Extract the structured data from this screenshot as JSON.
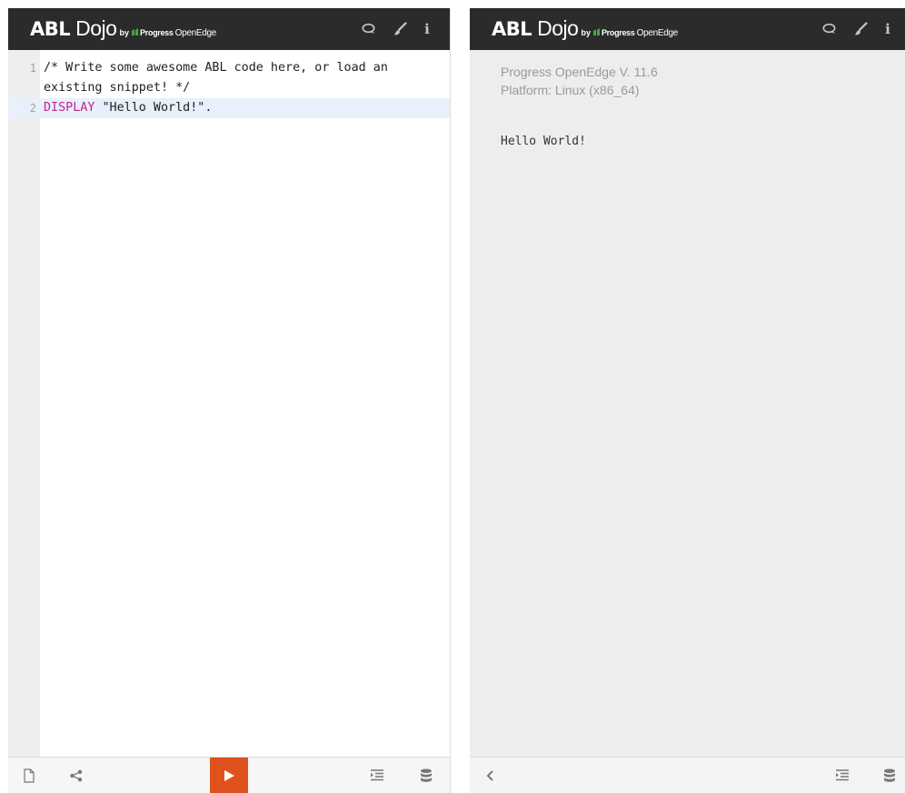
{
  "brand": {
    "abl": "ABL",
    "dojo": "Dojo",
    "by": "by",
    "progress": "Progress",
    "openedge": "OpenEdge",
    "colors": {
      "header": "#2b2b2b",
      "run": "#e0521d",
      "keyword": "#c0258c",
      "green": "#3faa3c"
    }
  },
  "header_icons": [
    "chat-icon",
    "brush-icon",
    "info-icon"
  ],
  "info_glyph": "i",
  "editor": {
    "lines": [
      {
        "number": "1",
        "text": "/* Write some awesome ABL code here, or load an existing snippet! */"
      },
      {
        "number": "2",
        "keyword": "DISPLAY",
        "rest": " \"Hello World!\"."
      }
    ]
  },
  "run_button": {
    "icon": "play-icon"
  },
  "left_footer_icons": [
    "new-file-icon",
    "share-icon",
    "format-icon",
    "database-icon"
  ],
  "output": {
    "version": "Progress OpenEdge V. 11.6",
    "platform": "Platform: Linux (x86_64)",
    "result": "Hello World!"
  },
  "right_footer_icons": [
    "collapse-icon",
    "format-icon",
    "database-icon"
  ]
}
